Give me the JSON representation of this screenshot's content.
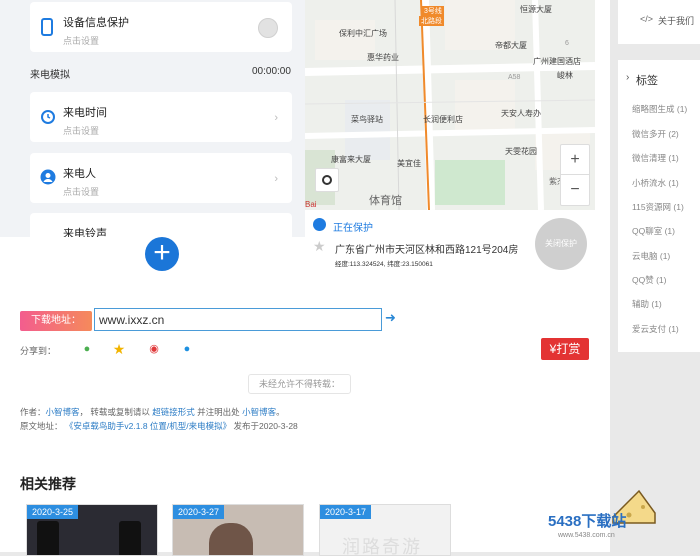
{
  "phone_ui": {
    "device_info": {
      "title": "设备信息保护",
      "subtitle": "点击设置"
    },
    "call_section": {
      "label": "来电模拟",
      "time": "00:00:00"
    },
    "call_time": {
      "title": "来电时间",
      "subtitle": "点击设置"
    },
    "caller": {
      "title": "来电人",
      "subtitle": "点击设置"
    },
    "ringtone": {
      "title": "来电铃声"
    }
  },
  "map": {
    "labels": [
      "保利中汇广场",
      "惠华药业",
      "3号线",
      "北路段",
      "恒源大厦",
      "帝都大厦",
      "广州建国酒店",
      "峻林",
      "A58",
      "6",
      "菜鸟驿站",
      "长润便利店",
      "天安人寿办",
      "天雯花园",
      "康富来大厦",
      "美宜佳",
      "体育馆",
      "紫杰",
      "Bai"
    ],
    "status": "正在保护",
    "address": "广东省广州市天河区林和西路121号204房",
    "coords": "经度:113.324524, 纬度:23.150061",
    "close_button": "关闭保护",
    "zoom_in": "+",
    "zoom_out": "−"
  },
  "download": {
    "label": "下载地址：",
    "url": "www.ixxz.cn"
  },
  "share": {
    "label": "分享到："
  },
  "reward": {
    "label": "¥打赏"
  },
  "notice": "未经允许不得转载：",
  "meta": {
    "author_prefix": "作者：",
    "author": "小智博客",
    "mid": "，  转载或复制请以",
    "link_form": "超链接形式",
    "mid2": "并注明出处",
    "site": "小智博客",
    "end": "。",
    "source_prefix": "原文地址：",
    "source_title": "《安卓载鸟助手v2.1.8 位置/机型/来电模拟》",
    "published": "发布于2020-3-28"
  },
  "related": {
    "title": "相关推荐",
    "items": [
      {
        "date": "2020-3-25"
      },
      {
        "date": "2020-3-27"
      },
      {
        "date": "2020-3-17"
      }
    ],
    "third_text": "润路奇游"
  },
  "sidebar": {
    "about": "关于我们",
    "tags_title": "标签",
    "tags": [
      "缩略图生成 (1)",
      "微信多开 (2)",
      "微信清理 (1)",
      "小桥流水 (1)",
      "115资源网 (1)",
      "QQ聊室 (1)",
      "云电脑 (1)",
      "QQ赞 (1)",
      "辅助 (1)",
      "爱云支付 (1)"
    ]
  },
  "watermark": {
    "brand": "5438下载站",
    "url": "www.5438.com.cn"
  }
}
